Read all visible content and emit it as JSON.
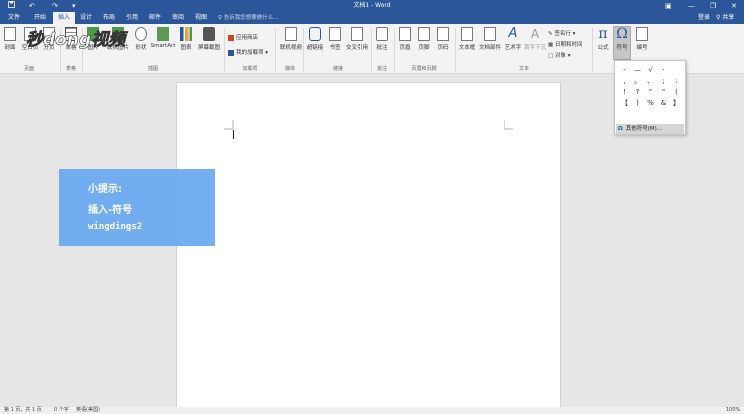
{
  "titlebar": {
    "title": "文档1 - Word",
    "save_icon": "save-icon",
    "undo": "↶",
    "redo": "↷",
    "customize": "▾",
    "ribbon_options": "▣",
    "minimize": "—",
    "restore": "❐",
    "close": "✕"
  },
  "menu": {
    "tabs": [
      "文件",
      "开始",
      "插入",
      "设计",
      "布局",
      "引用",
      "邮件",
      "审阅",
      "视图"
    ],
    "active_tab": "插入",
    "tell_me": "♀ 告诉我您想要做什么...",
    "login": "登录",
    "share": "♀ 共享"
  },
  "ribbon": {
    "cover": "封面",
    "blank_page": "空白页",
    "page_break": "分页",
    "table": "表格",
    "pictures": "图片",
    "online_pictures": "联机图片",
    "shapes": "形状",
    "smartart": "SmartArt",
    "chart": "图表",
    "screenshot": "屏幕截图",
    "store": "应用商店",
    "my_addins": "我的加载项",
    "online_video": "联机视频",
    "hyperlink": "超链接",
    "bookmark": "书签",
    "cross_ref": "交叉引用",
    "comment": "批注",
    "header": "页眉",
    "footer": "页脚",
    "page_number": "页码",
    "textbox": "文本框",
    "quick_parts": "文档部件",
    "wordart": "艺术字",
    "dropcap": "首字下沉",
    "signature": "签名行",
    "datetime": "日期和时间",
    "object": "对象",
    "equation": "公式",
    "symbol": "符号",
    "number": "编号",
    "groups": {
      "pages": "页面",
      "tables": "表格",
      "illustrations": "插图",
      "addins": "加载项",
      "media": "媒体",
      "links": "链接",
      "comments": "批注",
      "header_footer": "页眉和页脚",
      "text": "文本"
    }
  },
  "symbols": {
    "grid": [
      "-",
      "—",
      "√",
      "·",
      "",
      ",",
      "。",
      "、",
      ";",
      ":",
      "!",
      "?",
      "\"",
      "\"",
      "(",
      "【",
      ")",
      "%",
      "&",
      "】"
    ],
    "more_label": "其他符号(M)..."
  },
  "hint": {
    "line1": "小提示:",
    "line2": "插入-符号",
    "line3": "wingdings2"
  },
  "watermark": "秒dong视频",
  "status": {
    "page": "第 1 页，共 1 页",
    "words": "0 个字",
    "language": "英语(美国)",
    "zoom": "100%"
  },
  "colors": {
    "accent": "#2b579a",
    "hint_bg": "#6aaaf0",
    "ribbon_bg": "#f3f3f3"
  }
}
